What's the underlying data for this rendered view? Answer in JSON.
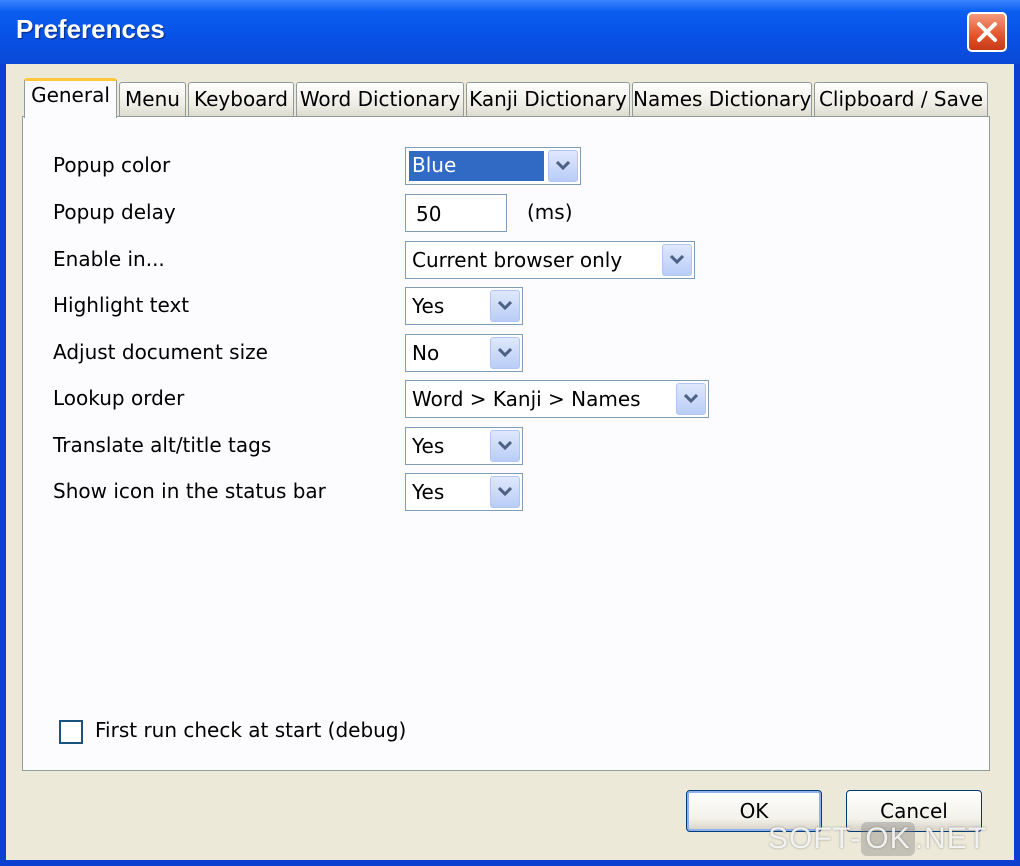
{
  "window": {
    "title": "Preferences"
  },
  "tabs": [
    {
      "label": "General",
      "active": true
    },
    {
      "label": "Menu"
    },
    {
      "label": "Keyboard"
    },
    {
      "label": "Word Dictionary"
    },
    {
      "label": "Kanji Dictionary"
    },
    {
      "label": "Names Dictionary"
    },
    {
      "label": "Clipboard / Save"
    }
  ],
  "settings": {
    "popup_color": {
      "label": "Popup color",
      "value": "Blue"
    },
    "popup_delay": {
      "label": "Popup delay",
      "value": "50",
      "unit": "(ms)"
    },
    "enable_in": {
      "label": "Enable in...",
      "value": "Current browser only"
    },
    "highlight_text": {
      "label": "Highlight text",
      "value": "Yes"
    },
    "adjust_document_size": {
      "label": "Adjust document size",
      "value": "No"
    },
    "lookup_order": {
      "label": "Lookup order",
      "value": "Word > Kanji > Names"
    },
    "translate_tags": {
      "label": "Translate alt/title tags",
      "value": "Yes"
    },
    "status_icon": {
      "label": "Show icon in the status bar",
      "value": "Yes"
    }
  },
  "debug_checkbox": {
    "label": "First run check at start (debug)",
    "checked": false
  },
  "buttons": {
    "ok": "OK",
    "cancel": "Cancel"
  },
  "watermark": {
    "part1": "SOFT-",
    "part2": "OK",
    "part3": ".NET"
  },
  "colors": {
    "titlebar": "#0a5ef0",
    "client": "#ece9d8",
    "selection": "#316ac5"
  },
  "icons": {
    "close": "close-icon",
    "dropdown": "chevron-down-icon"
  }
}
